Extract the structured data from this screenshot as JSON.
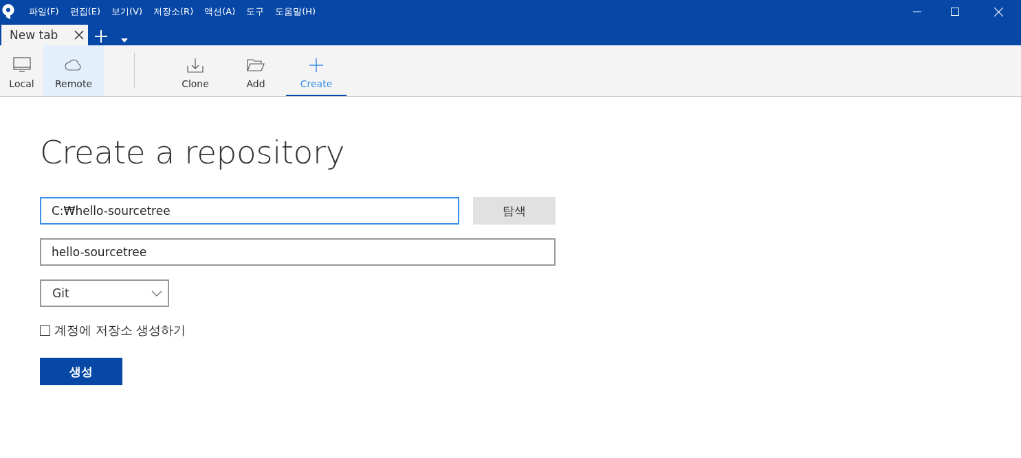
{
  "menu": [
    "파일(F)",
    "편집(E)",
    "보기(V)",
    "저장소(R)",
    "액션(A)",
    "도구",
    "도움말(H)"
  ],
  "tabs": [
    {
      "label": "New tab",
      "selected": true
    }
  ],
  "toolbar": [
    {
      "label": "Local",
      "kind": "local",
      "selected": false,
      "highlighted": false
    },
    {
      "label": "Remote",
      "kind": "remote",
      "selected": false,
      "highlighted": true
    },
    {
      "kind": "separator"
    },
    {
      "label": "Clone",
      "kind": "clone",
      "selected": false,
      "highlighted": false
    },
    {
      "label": "Add",
      "kind": "add",
      "selected": false,
      "highlighted": false
    },
    {
      "label": "Create",
      "kind": "create",
      "selected": true,
      "highlighted": false
    }
  ],
  "heading": "Create a repository",
  "path_field": {
    "value": "C:₩hello-sourcetree",
    "focused": true
  },
  "browse_button": "탐색",
  "name_field": {
    "value": "hello-sourcetree",
    "focused": false
  },
  "type_select": {
    "value": "Git"
  },
  "account_checkbox": {
    "label": "계정에 저장소 생성하기",
    "checked": false
  },
  "create_button": "생성"
}
